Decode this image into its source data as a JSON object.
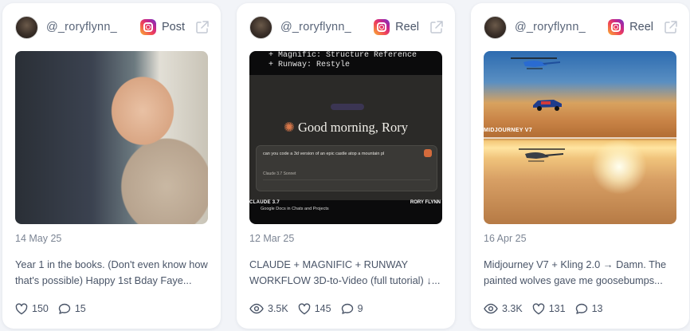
{
  "cards": [
    {
      "handle": "@_roryflynn_",
      "type": "Post",
      "date": "14 May 25",
      "caption_line1": "Year 1 in the books. (Don't even know how",
      "caption_line2": "that's possible) Happy 1st Bday Faye...",
      "likes": "150",
      "comments": "15"
    },
    {
      "handle": "@_roryflynn_",
      "type": "Reel",
      "date": "12 Mar 25",
      "caption_line1": "CLAUDE + MAGNIFIC + RUNWAY",
      "caption_line2": "WORKFLOW 3D-to-Video (full tutorial) ↓...",
      "views": "3.5K",
      "likes": "145",
      "comments": "9",
      "media": {
        "code_line1": "+ Magnific: Structure Reference",
        "code_line2": "+ Runway: Restyle",
        "greeting": "Good morning, Rory",
        "prompt": "can you code a 3d version of an epic castle atop a mountain pl",
        "model": "Claude 3.7 Sonnet",
        "caption_left": "CLAUDE 3.7",
        "caption_mid": "Google Docs in Chats and Projects",
        "caption_right": "RORY FLYNN"
      }
    },
    {
      "handle": "@_roryflynn_",
      "type": "Reel",
      "date": "16 Apr 25",
      "caption_line1": "Midjourney V7 + Kling 2.0 → Damn. The",
      "caption_line2": "painted wolves gave me goosebumps...",
      "views": "3.3K",
      "likes": "131",
      "comments": "13",
      "media": {
        "caption": "MIDJOURNEY V7"
      }
    }
  ]
}
